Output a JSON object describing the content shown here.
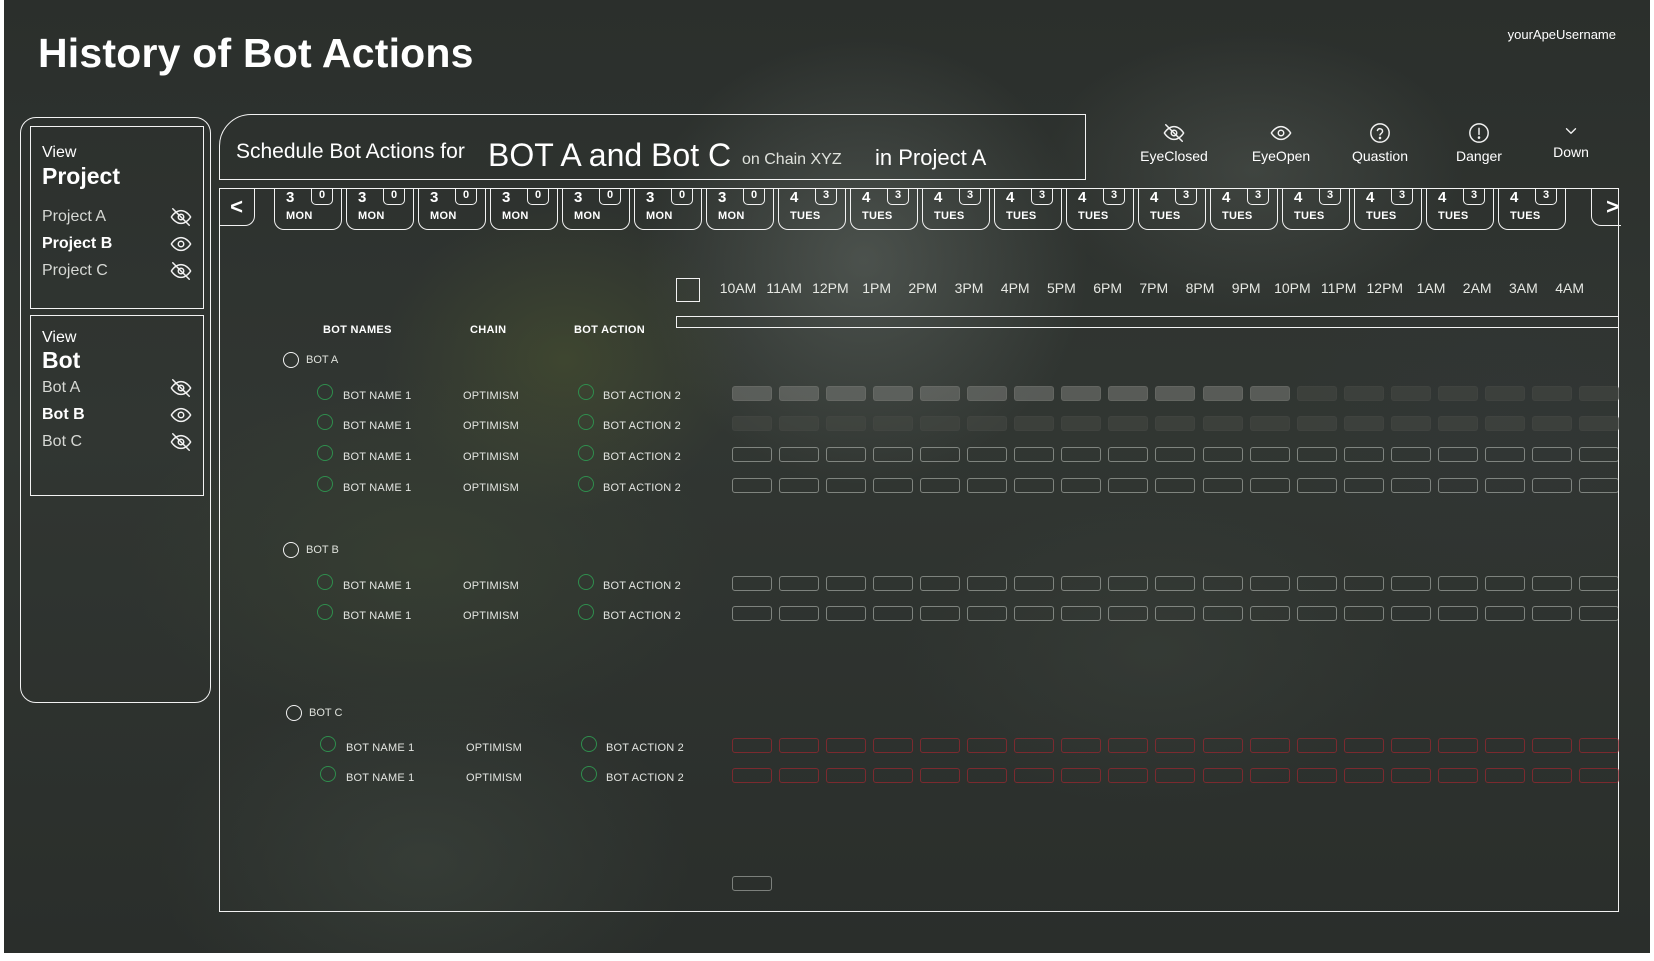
{
  "page": {
    "title": "History of Bot Actions",
    "username": "yourApeUsername"
  },
  "project_panel": {
    "view_label": "View",
    "heading": "Project",
    "items": [
      {
        "label": "Project A",
        "visibility": "eye-closed",
        "bold": false
      },
      {
        "label": "Project B",
        "visibility": "eye-open",
        "bold": true
      },
      {
        "label": "Project C",
        "visibility": "eye-closed",
        "bold": false
      }
    ]
  },
  "bot_panel": {
    "view_label": "View",
    "heading": "Bot",
    "items": [
      {
        "label": "Bot A",
        "visibility": "eye-closed",
        "bold": false
      },
      {
        "label": "Bot B",
        "visibility": "eye-open",
        "bold": true
      },
      {
        "label": "Bot C",
        "visibility": "eye-closed",
        "bold": false
      }
    ]
  },
  "schedule_header": {
    "prefix": "Schedule Bot Actions for",
    "bots": "BOT A and Bot C",
    "chain": "on Chain XYZ",
    "project": "in Project A"
  },
  "legend": [
    {
      "icon": "eye-closed-icon",
      "label": "EyeClosed"
    },
    {
      "icon": "eye-open-icon",
      "label": "EyeOpen"
    },
    {
      "icon": "question-icon",
      "label": "Quastion"
    },
    {
      "icon": "danger-icon",
      "label": "Danger"
    },
    {
      "icon": "chevron-down-icon",
      "label": "Down"
    }
  ],
  "date_nav": {
    "prev": "<",
    "next": ">"
  },
  "days": [
    {
      "num": "3",
      "dow": "MON",
      "count": "0"
    },
    {
      "num": "3",
      "dow": "MON",
      "count": "0"
    },
    {
      "num": "3",
      "dow": "MON",
      "count": "0"
    },
    {
      "num": "3",
      "dow": "MON",
      "count": "0"
    },
    {
      "num": "3",
      "dow": "MON",
      "count": "0"
    },
    {
      "num": "3",
      "dow": "MON",
      "count": "0"
    },
    {
      "num": "3",
      "dow": "MON",
      "count": "0"
    },
    {
      "num": "4",
      "dow": "TUES",
      "count": "3"
    },
    {
      "num": "4",
      "dow": "TUES",
      "count": "3"
    },
    {
      "num": "4",
      "dow": "TUES",
      "count": "3"
    },
    {
      "num": "4",
      "dow": "TUES",
      "count": "3"
    },
    {
      "num": "4",
      "dow": "TUES",
      "count": "3"
    },
    {
      "num": "4",
      "dow": "TUES",
      "count": "3"
    },
    {
      "num": "4",
      "dow": "TUES",
      "count": "3"
    },
    {
      "num": "4",
      "dow": "TUES",
      "count": "3"
    },
    {
      "num": "4",
      "dow": "TUES",
      "count": "3"
    },
    {
      "num": "4",
      "dow": "TUES",
      "count": "3"
    },
    {
      "num": "4",
      "dow": "TUES",
      "count": "3"
    }
  ],
  "times": [
    "10AM",
    "11AM",
    "12PM",
    "1PM",
    "2PM",
    "3PM",
    "4PM",
    "5PM",
    "6PM",
    "7PM",
    "8PM",
    "9PM",
    "10PM",
    "11PM",
    "12PM",
    "1AM",
    "2AM",
    "3AM",
    "4AM"
  ],
  "columns": {
    "bot_names": "BOT NAMES",
    "chain": "CHAIN",
    "bot_action": "BOT ACTION"
  },
  "groups": [
    {
      "name": "BOT A",
      "rows": [
        {
          "bot_name": "BOT NAME 1",
          "chain": "OPTIMISM",
          "action": "BOT ACTION 2",
          "slot_style": "filled"
        },
        {
          "bot_name": "BOT NAME 1",
          "chain": "OPTIMISM",
          "action": "BOT ACTION 2",
          "slot_style": "filled-dark"
        },
        {
          "bot_name": "BOT NAME 1",
          "chain": "OPTIMISM",
          "action": "BOT ACTION 2",
          "slot_style": "outline"
        },
        {
          "bot_name": "BOT NAME 1",
          "chain": "OPTIMISM",
          "action": "BOT ACTION 2",
          "slot_style": "outline"
        }
      ]
    },
    {
      "name": "BOT B",
      "rows": [
        {
          "bot_name": "BOT NAME 1",
          "chain": "OPTIMISM",
          "action": "BOT ACTION 2",
          "slot_style": "outline"
        },
        {
          "bot_name": "BOT NAME 1",
          "chain": "OPTIMISM",
          "action": "BOT ACTION 2",
          "slot_style": "outline"
        }
      ]
    },
    {
      "name": "BOT C",
      "rows": [
        {
          "bot_name": "BOT NAME 1",
          "chain": "OPTIMISM",
          "action": "BOT ACTION 2",
          "slot_style": "red"
        },
        {
          "bot_name": "BOT NAME 1",
          "chain": "OPTIMISM",
          "action": "BOT ACTION 2",
          "slot_style": "red"
        }
      ]
    }
  ],
  "colors": {
    "accent_green": "#2f8e4d",
    "alert_red": "#962830",
    "outline": "#f2f2f2"
  }
}
